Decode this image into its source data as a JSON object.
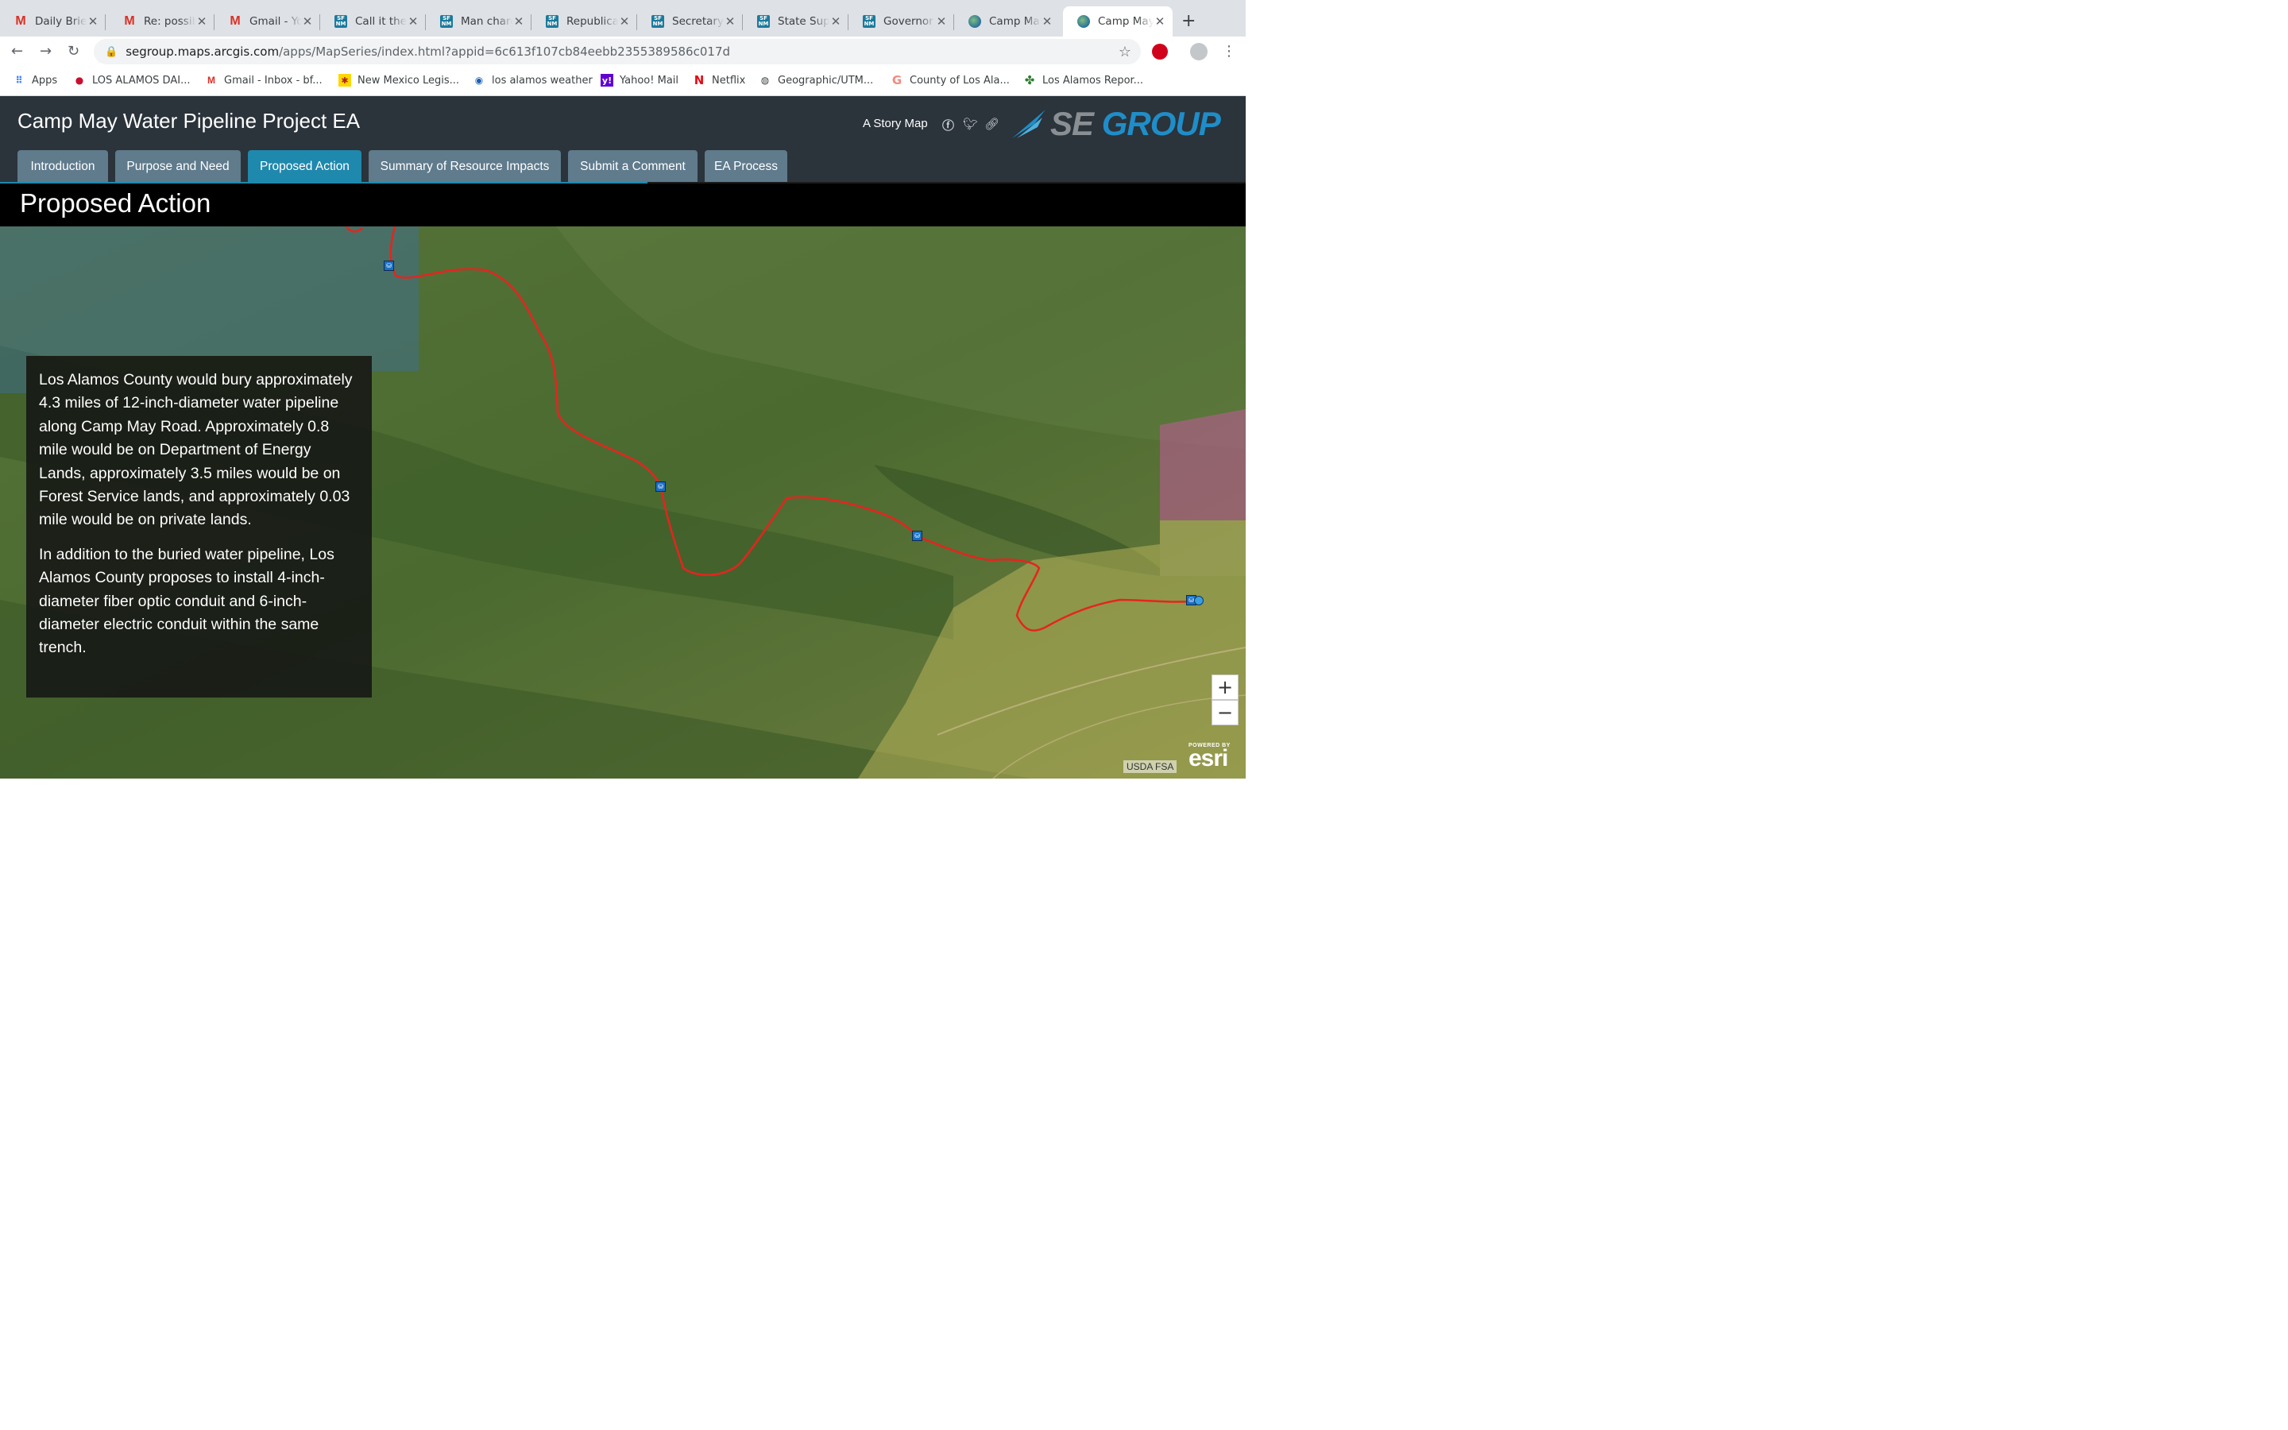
{
  "browser": {
    "tabs": [
      {
        "title": "Daily Briefing",
        "icon": "gmail-icon"
      },
      {
        "title": "Re: possible",
        "icon": "gmail-icon"
      },
      {
        "title": "Gmail - Your",
        "icon": "gmail-icon"
      },
      {
        "title": "Call it the",
        "icon": "sfnm-icon"
      },
      {
        "title": "Man charged",
        "icon": "sfnm-icon"
      },
      {
        "title": "Republicans",
        "icon": "sfnm-icon"
      },
      {
        "title": "Secretary",
        "icon": "sfnm-icon"
      },
      {
        "title": "State Supreme",
        "icon": "sfnm-icon"
      },
      {
        "title": "Governor",
        "icon": "sfnm-icon"
      },
      {
        "title": "Camp May",
        "icon": "globe-icon"
      },
      {
        "title": "Camp May",
        "icon": "globe-icon",
        "active": true
      }
    ],
    "url_host": "segroup.maps.arcgis.com",
    "url_path": "/apps/MapSeries/index.html?appid=6c613f107cb84eebb2355389586c017d",
    "bookmarks": [
      {
        "label": "Apps",
        "icon": "apps-grid-icon"
      },
      {
        "label": "LOS ALAMOS DAI...",
        "icon": "newspaper-icon"
      },
      {
        "label": "Gmail - Inbox - bf...",
        "icon": "gmail-icon"
      },
      {
        "label": "New Mexico Legis...",
        "icon": "zia-icon"
      },
      {
        "label": "los alamos weather",
        "icon": "noaa-icon"
      },
      {
        "label": "Yahoo! Mail",
        "icon": "yahoo-icon"
      },
      {
        "label": "Netflix",
        "icon": "netflix-icon"
      },
      {
        "label": "Geographic/UTM...",
        "icon": "globe-icon"
      },
      {
        "label": "County of Los Ala...",
        "icon": "county-icon"
      },
      {
        "label": "Los Alamos Repor...",
        "icon": "clover-icon"
      }
    ]
  },
  "app": {
    "title": "Camp May Water Pipeline Project EA",
    "story_map_label": "A Story Map",
    "logo_se": "SE",
    "logo_group": "GROUP",
    "nav_tabs": [
      {
        "label": "Introduction"
      },
      {
        "label": "Purpose and Need"
      },
      {
        "label": "Proposed Action",
        "active": true
      },
      {
        "label": "Summary of Resource Impacts"
      },
      {
        "label": "Submit a Comment"
      },
      {
        "label": "EA Process"
      }
    ],
    "progress_fraction": 0.52,
    "section_title": "Proposed Action"
  },
  "narrative": {
    "paragraphs": [
      "Los Alamos County would bury approximately 4.3 miles of 12-inch-diameter water pipeline along Camp May Road. Approximately 0.8 mile would be on Department of Energy Lands, approximately 3.5 miles would be on Forest Service lands, and approximately 0.03 mile would be on private lands.",
      "In addition to the buried water pipeline, Los Alamos County proposes to install 4-inch-diameter fiber optic conduit and 6-inch-diameter electric conduit within the same trench."
    ]
  },
  "map": {
    "zoom_in": "+",
    "zoom_out": "−",
    "attribution": "USDA FSA",
    "esri_powered": "POWERED BY",
    "esri_name": "esri",
    "route_color": "#e8231e",
    "marker_icon": "water-tank-icon"
  }
}
